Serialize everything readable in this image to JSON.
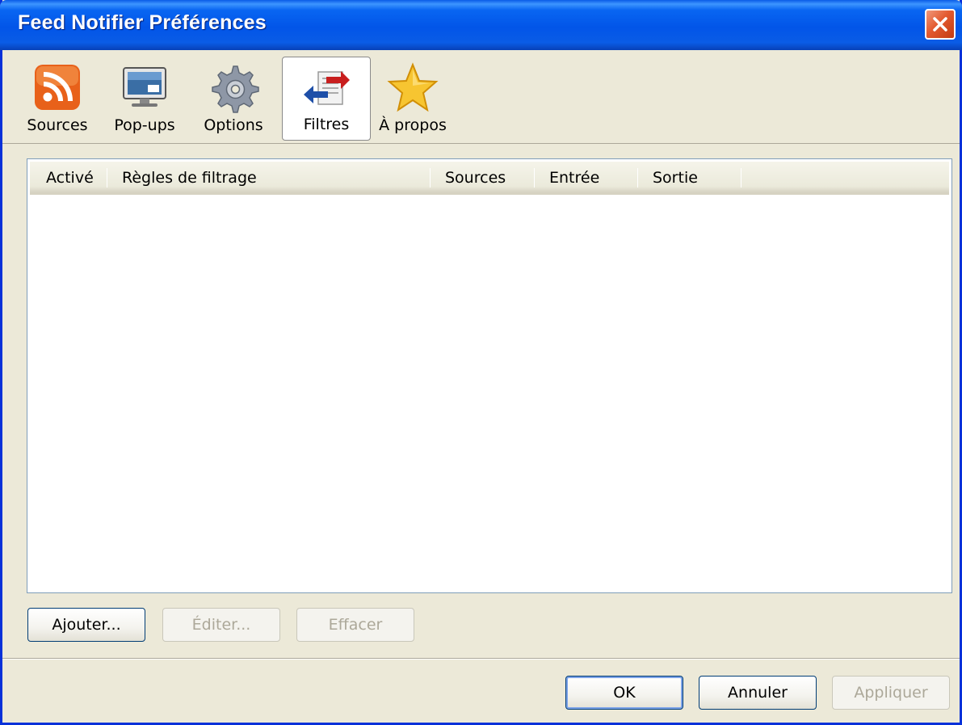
{
  "window": {
    "title": "Feed Notifier Préférences"
  },
  "toolbar": {
    "items": [
      {
        "label": "Sources",
        "icon": "rss-feed-icon"
      },
      {
        "label": "Pop-ups",
        "icon": "monitor-icon"
      },
      {
        "label": "Options",
        "icon": "gear-icon"
      },
      {
        "label": "Filtres",
        "icon": "filter-arrows-icon",
        "selected": true
      },
      {
        "label": "À propos",
        "icon": "star-icon"
      }
    ]
  },
  "filters_table": {
    "columns": [
      "Activé",
      "Règles de filtrage",
      "Sources",
      "Entrée",
      "Sortie"
    ],
    "rows": []
  },
  "list_buttons": {
    "add": "Ajouter...",
    "edit": "Éditer...",
    "delete": "Effacer"
  },
  "dialog_buttons": {
    "ok": "OK",
    "cancel": "Annuler",
    "apply": "Appliquer"
  },
  "colors": {
    "titlebar": "#0255e8",
    "close": "#e35a30",
    "dialog_bg": "#ece9d8",
    "list_border": "#7f9db9"
  }
}
